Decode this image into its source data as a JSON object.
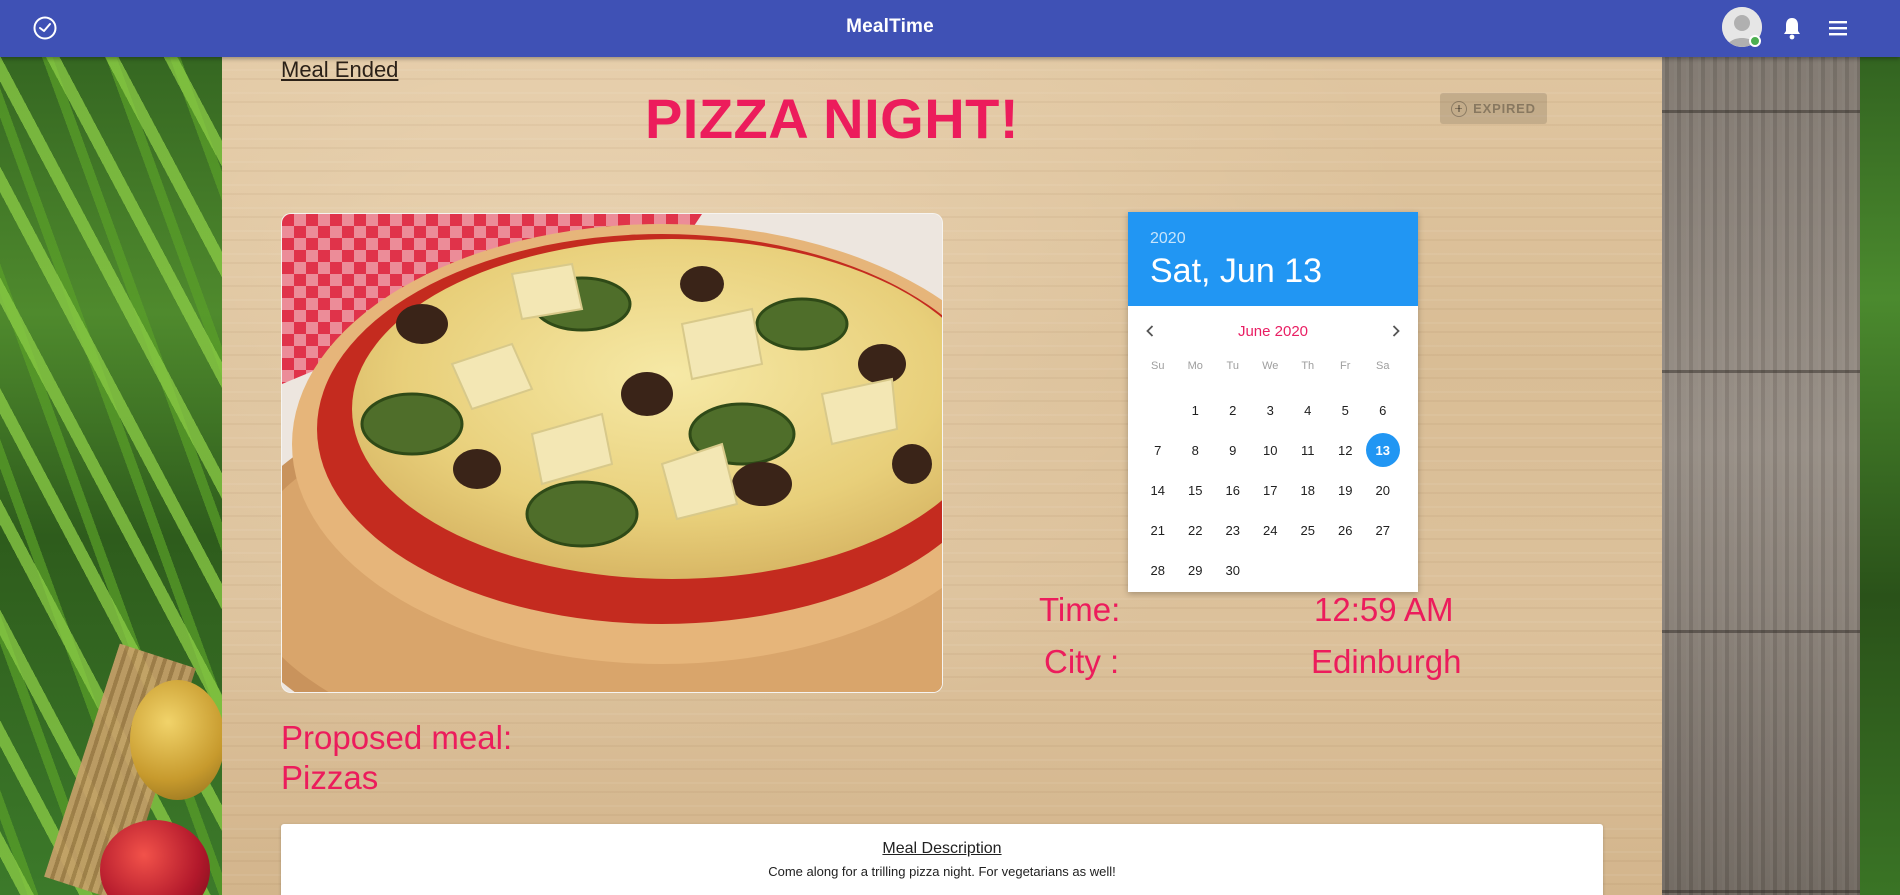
{
  "app": {
    "title": "MealTime"
  },
  "header": {
    "logo_icon": "clock-icon",
    "avatar_icon": "user-avatar",
    "notifications_icon": "bell-icon",
    "menu_icon": "hamburger-menu-icon",
    "bar_color": "#3f51b5"
  },
  "meal": {
    "status_link": "Meal Ended",
    "title": "PIZZA NIGHT!",
    "expired_button": "EXPIRED",
    "proposed_label": "Proposed meal:",
    "proposed_value": "Pizzas",
    "time_label": "Time:",
    "time_value": "12:59 AM",
    "city_label": "City :",
    "city_value": "Edinburgh",
    "accent_color": "#ec1c5c"
  },
  "datepicker": {
    "year": "2020",
    "selected_label": "Sat, Jun 13",
    "month_label": "June 2020",
    "weekdays": [
      "Su",
      "Mo",
      "Tu",
      "We",
      "Th",
      "Fr",
      "Sa"
    ],
    "first_weekday_offset": 1,
    "days": [
      "1",
      "2",
      "3",
      "4",
      "5",
      "6",
      "7",
      "8",
      "9",
      "10",
      "11",
      "12",
      "13",
      "14",
      "15",
      "16",
      "17",
      "18",
      "19",
      "20",
      "21",
      "22",
      "23",
      "24",
      "25",
      "26",
      "27",
      "28",
      "29",
      "30"
    ],
    "selected_day": "13",
    "header_color": "#2196f3"
  },
  "description": {
    "title": "Meal Description",
    "text": "Come along for a trilling pizza night. For vegetarians as well!"
  }
}
